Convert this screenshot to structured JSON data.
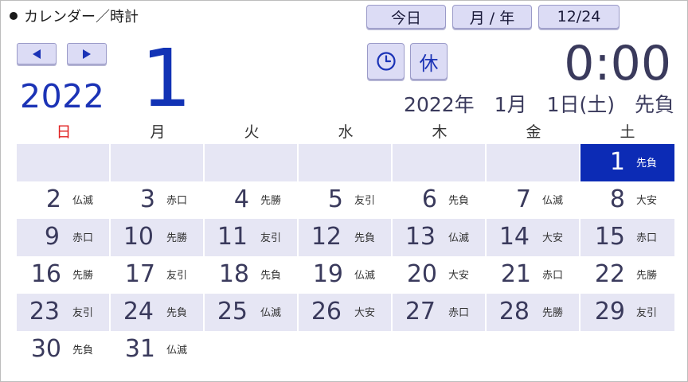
{
  "header": {
    "title": "カレンダー／時計"
  },
  "buttons": {
    "today": "今日",
    "month_year": "月 / 年",
    "date": "12/24",
    "holiday": "休"
  },
  "icons": {
    "prev": "left-arrow-icon",
    "next": "right-arrow-icon",
    "clock": "clock-icon"
  },
  "current": {
    "year": "2022",
    "month": "1",
    "time": "0:00",
    "full_date": "2022年　1月　1日(土)　先負"
  },
  "weekdays": [
    "日",
    "月",
    "火",
    "水",
    "木",
    "金",
    "土"
  ],
  "colors": {
    "accent": "#0c2bb5",
    "sunday": "#e02020",
    "button": "#dcdcf5",
    "shade": "#e6e6f4"
  },
  "calendar": {
    "selected_day": "1",
    "weeks": [
      [
        {
          "day": "",
          "rokuyo": ""
        },
        {
          "day": "",
          "rokuyo": ""
        },
        {
          "day": "",
          "rokuyo": ""
        },
        {
          "day": "",
          "rokuyo": ""
        },
        {
          "day": "",
          "rokuyo": ""
        },
        {
          "day": "",
          "rokuyo": ""
        },
        {
          "day": "1",
          "rokuyo": "先負"
        }
      ],
      [
        {
          "day": "2",
          "rokuyo": "仏滅"
        },
        {
          "day": "3",
          "rokuyo": "赤口"
        },
        {
          "day": "4",
          "rokuyo": "先勝"
        },
        {
          "day": "5",
          "rokuyo": "友引"
        },
        {
          "day": "6",
          "rokuyo": "先負"
        },
        {
          "day": "7",
          "rokuyo": "仏滅"
        },
        {
          "day": "8",
          "rokuyo": "大安"
        }
      ],
      [
        {
          "day": "9",
          "rokuyo": "赤口"
        },
        {
          "day": "10",
          "rokuyo": "先勝"
        },
        {
          "day": "11",
          "rokuyo": "友引"
        },
        {
          "day": "12",
          "rokuyo": "先負"
        },
        {
          "day": "13",
          "rokuyo": "仏滅"
        },
        {
          "day": "14",
          "rokuyo": "大安"
        },
        {
          "day": "15",
          "rokuyo": "赤口"
        }
      ],
      [
        {
          "day": "16",
          "rokuyo": "先勝"
        },
        {
          "day": "17",
          "rokuyo": "友引"
        },
        {
          "day": "18",
          "rokuyo": "先負"
        },
        {
          "day": "19",
          "rokuyo": "仏滅"
        },
        {
          "day": "20",
          "rokuyo": "大安"
        },
        {
          "day": "21",
          "rokuyo": "赤口"
        },
        {
          "day": "22",
          "rokuyo": "先勝"
        }
      ],
      [
        {
          "day": "23",
          "rokuyo": "友引"
        },
        {
          "day": "24",
          "rokuyo": "先負"
        },
        {
          "day": "25",
          "rokuyo": "仏滅"
        },
        {
          "day": "26",
          "rokuyo": "大安"
        },
        {
          "day": "27",
          "rokuyo": "赤口"
        },
        {
          "day": "28",
          "rokuyo": "先勝"
        },
        {
          "day": "29",
          "rokuyo": "友引"
        }
      ],
      [
        {
          "day": "30",
          "rokuyo": "先負"
        },
        {
          "day": "31",
          "rokuyo": "仏滅"
        },
        {
          "day": "",
          "rokuyo": ""
        },
        {
          "day": "",
          "rokuyo": ""
        },
        {
          "day": "",
          "rokuyo": ""
        },
        {
          "day": "",
          "rokuyo": ""
        },
        {
          "day": "",
          "rokuyo": ""
        }
      ]
    ]
  }
}
